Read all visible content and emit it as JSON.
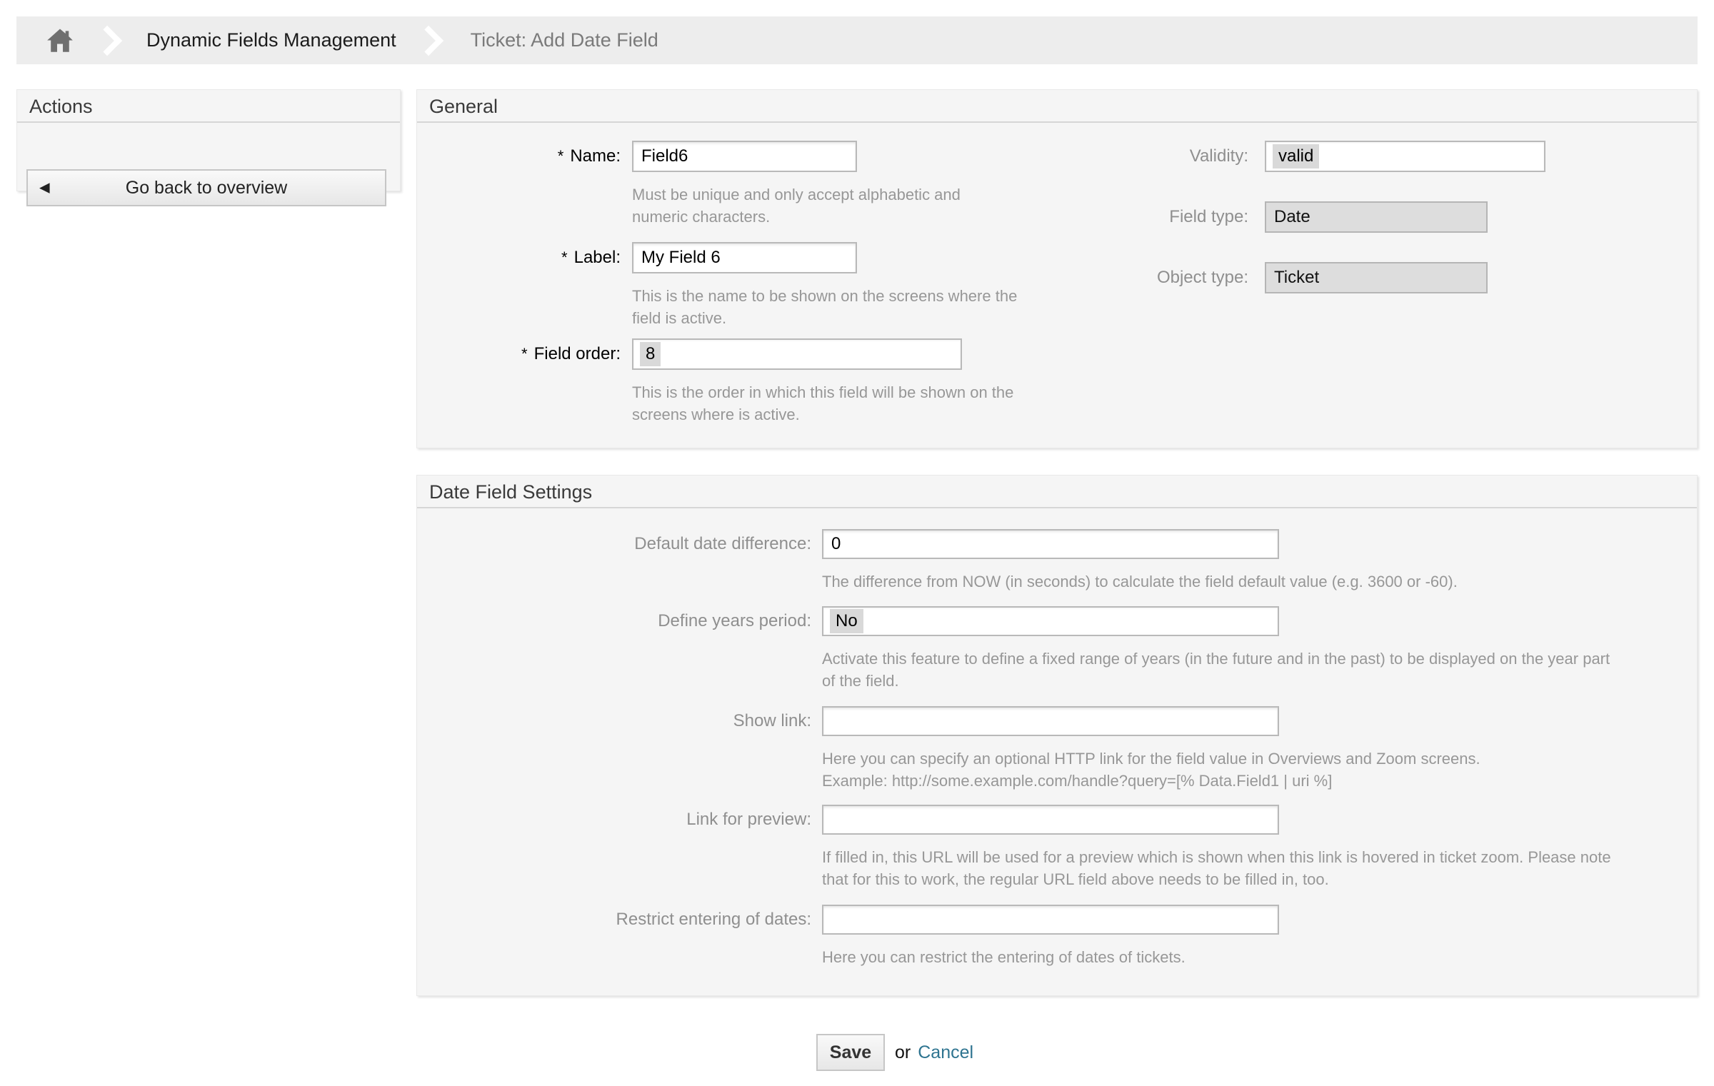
{
  "breadcrumb": {
    "items": [
      {
        "label": "Dynamic Fields Management"
      },
      {
        "label": "Ticket: Add Date Field"
      }
    ]
  },
  "actions": {
    "title": "Actions",
    "back_icon": "◀",
    "back_label": "Go back to overview"
  },
  "general": {
    "title": "General",
    "required_marker": "*",
    "name": {
      "label": "Name:",
      "value": "Field6",
      "hint": "Must be unique and only accept alphabetic and\nnumeric characters."
    },
    "label_field": {
      "label": "Label:",
      "value": "My Field 6",
      "hint": "This is the name to be shown on the screens where the\nfield is active."
    },
    "field_order": {
      "label": "Field order:",
      "value": "8",
      "hint": "This is the order in which this field will be shown on the\nscreens where is active."
    },
    "validity": {
      "label": "Validity:",
      "value": "valid"
    },
    "field_type": {
      "label": "Field type:",
      "value": "Date"
    },
    "object_type": {
      "label": "Object type:",
      "value": "Ticket"
    }
  },
  "settings": {
    "title": "Date Field Settings",
    "default_date_difference": {
      "label": "Default date difference:",
      "value": "0",
      "hint": "The difference from NOW (in seconds) to calculate the field default value (e.g. 3600 or -60)."
    },
    "years_period": {
      "label": "Define years period:",
      "value": "No",
      "hint": "Activate this feature to define a fixed range of years (in the future and in the past) to be displayed on the year part\nof the field."
    },
    "show_link": {
      "label": "Show link:",
      "value": "",
      "hint": "Here you can specify an optional HTTP link for the field value in Overviews and Zoom screens.\nExample: http://some.example.com/handle?query=[% Data.Field1 | uri %]"
    },
    "link_preview": {
      "label": "Link for preview:",
      "value": "",
      "hint": "If filled in, this URL will be used for a preview which is shown when this link is hovered in ticket zoom. Please note\nthat for this to work, the regular URL field above needs to be filled in, too."
    },
    "restrict_dates": {
      "label": "Restrict entering of dates:",
      "value": "",
      "hint": "Here you can restrict the entering of dates of tickets."
    }
  },
  "footer": {
    "save": "Save",
    "conjunction": "or",
    "cancel": "Cancel"
  },
  "colors": {
    "link": "#2e7490",
    "selection_highlight": "#d9d9d9",
    "breadcrumb_bg": "#ededed",
    "widget_bg": "#f5f5f5"
  }
}
